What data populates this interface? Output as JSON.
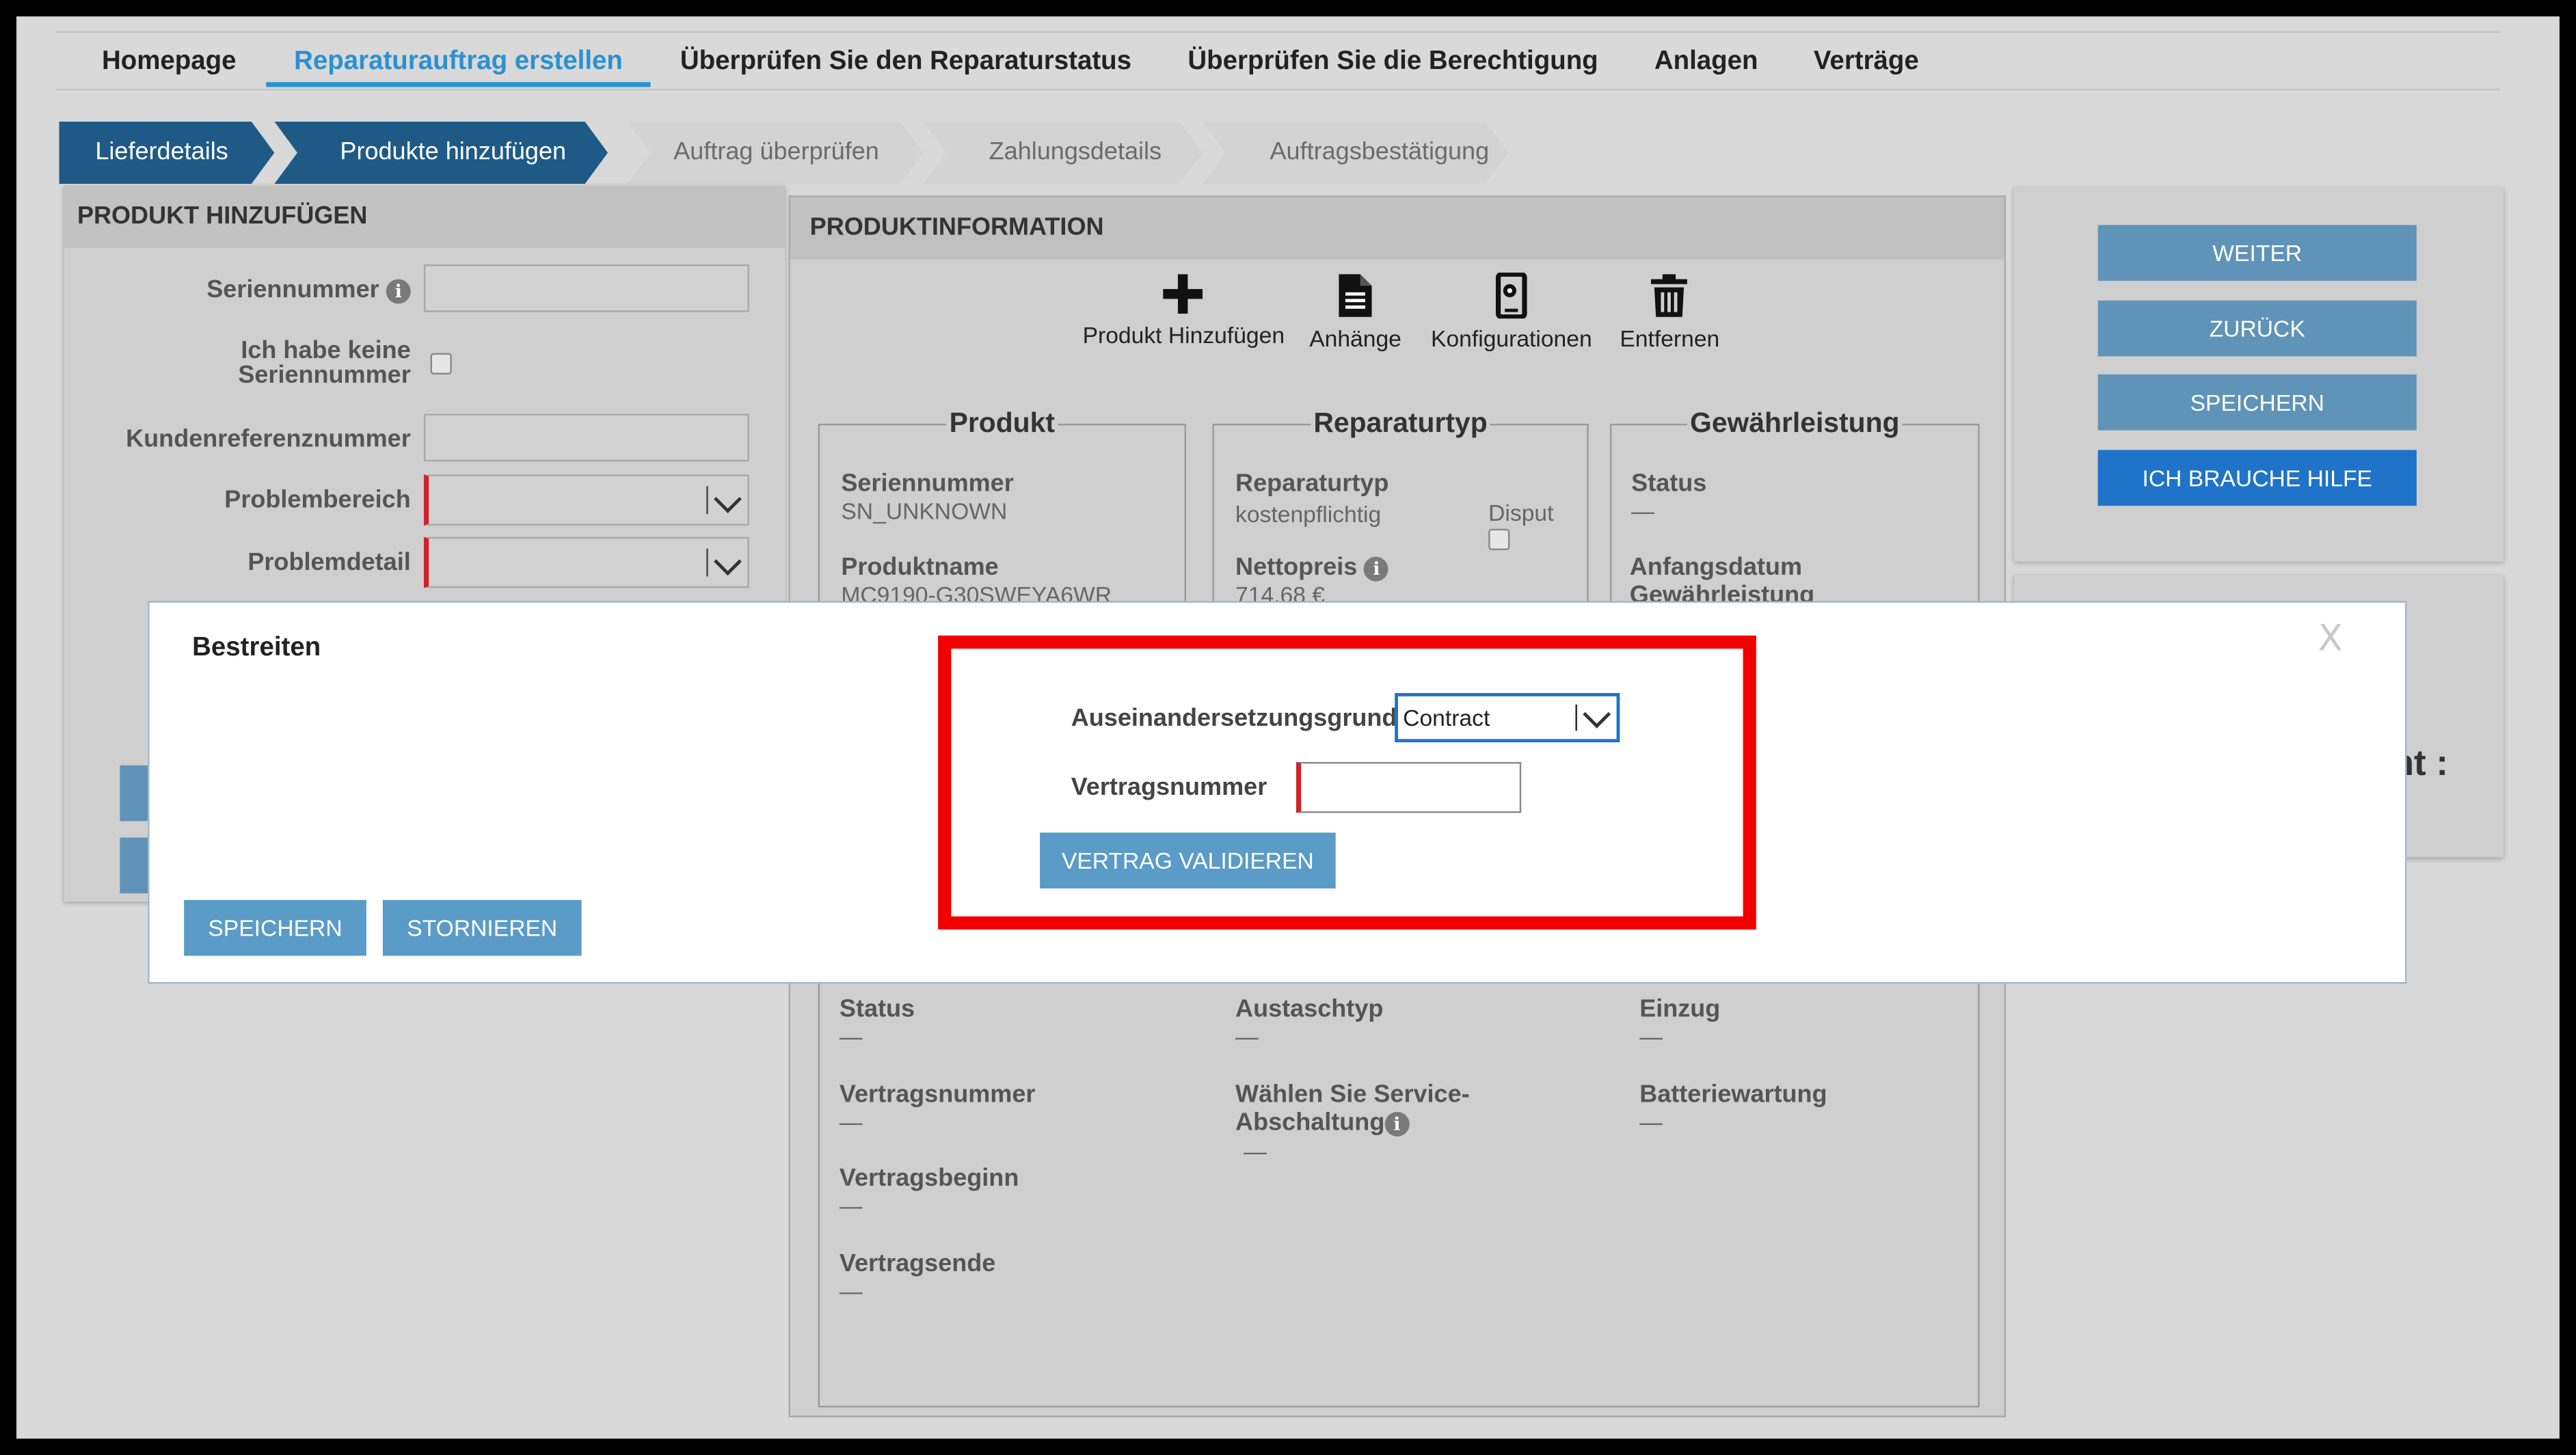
{
  "nav": {
    "items": [
      "Homepage",
      "Reparaturauftrag erstellen",
      "Überprüfen Sie den Reparaturstatus",
      "Überprüfen Sie die Berechtigung",
      "Anlagen",
      "Verträge"
    ],
    "active_index": 1
  },
  "steps": [
    {
      "label": "Lieferdetails",
      "state": "done"
    },
    {
      "label": "Produkte hinzufügen",
      "state": "current"
    },
    {
      "label": "Auftrag überprüfen",
      "state": "todo"
    },
    {
      "label": "Zahlungsdetails",
      "state": "todo"
    },
    {
      "label": "Auftragsbestätigung",
      "state": "todo"
    }
  ],
  "left_panel": {
    "title": "PRODUKT HINZUFÜGEN",
    "serial_label": "Seriennummer",
    "no_serial_label_line1": "Ich habe keine",
    "no_serial_label_line2": "Seriennummer",
    "customer_ref_label": "Kundenreferenznummer",
    "problem_area_label": "Problembereich",
    "problem_detail_label": "Problemdetail"
  },
  "center_panel": {
    "title": "PRODUKTINFORMATION",
    "tools": {
      "add": "Produkt Hinzufügen",
      "attachments": "Anhänge",
      "configurations": "Konfigurationen",
      "remove": "Entfernen"
    },
    "product": {
      "legend": "Produkt",
      "serial_label": "Seriennummer",
      "serial_value": "SN_UNKNOWN",
      "name_label": "Produktname",
      "name_value": "MC9190-G30SWEYA6WR"
    },
    "repair": {
      "legend": "Reparaturtyp",
      "type_label": "Reparaturtyp",
      "type_value": "kostenpflichtig",
      "dispute_label": "Disput",
      "net_label": "Nettopreis",
      "net_value": "714,68 €"
    },
    "warranty": {
      "legend": "Gewährleistung",
      "status_label": "Status",
      "status_value": "—",
      "start_label_line1": "Anfangsdatum",
      "start_label_line2": "Gewährleistung"
    },
    "lower": {
      "status_label": "Status",
      "status_value": "—",
      "contract_no_label": "Vertragsnummer",
      "contract_no_value": "—",
      "contract_start_label": "Vertragsbeginn",
      "contract_start_value": "—",
      "contract_end_label": "Vertragsende",
      "contract_end_value": "—",
      "exchange_label": "Austaschtyp",
      "exchange_value": "—",
      "service_label_line1": "Wählen Sie Service-",
      "service_label_line2": "Abschaltung",
      "service_value": "—",
      "collection_label": "Einzug",
      "collection_value": "—",
      "battery_label": "Batteriewartung",
      "battery_value": "—"
    }
  },
  "right_panel": {
    "next": "WEITER",
    "back": "ZURÜCK",
    "save": "SPEICHERN",
    "help": "ICH BRAUCHE HILFE",
    "partial_text": "nt :"
  },
  "modal": {
    "title": "Bestreiten",
    "close": "X",
    "reason_label": "Auseinandersetzungsgrund",
    "reason_value": "Contract",
    "contract_label": "Vertragsnummer",
    "contract_value": "",
    "validate": "VERTRAG VALIDIEREN",
    "save": "SPEICHERN",
    "cancel": "STORNIEREN"
  },
  "colors": {
    "accent": "#2b91d1",
    "step_done": "#1f5a86",
    "button": "#5f93b8",
    "primary_button": "#1f73c8",
    "required_marker": "#d0202a",
    "highlight": "#f20000"
  }
}
